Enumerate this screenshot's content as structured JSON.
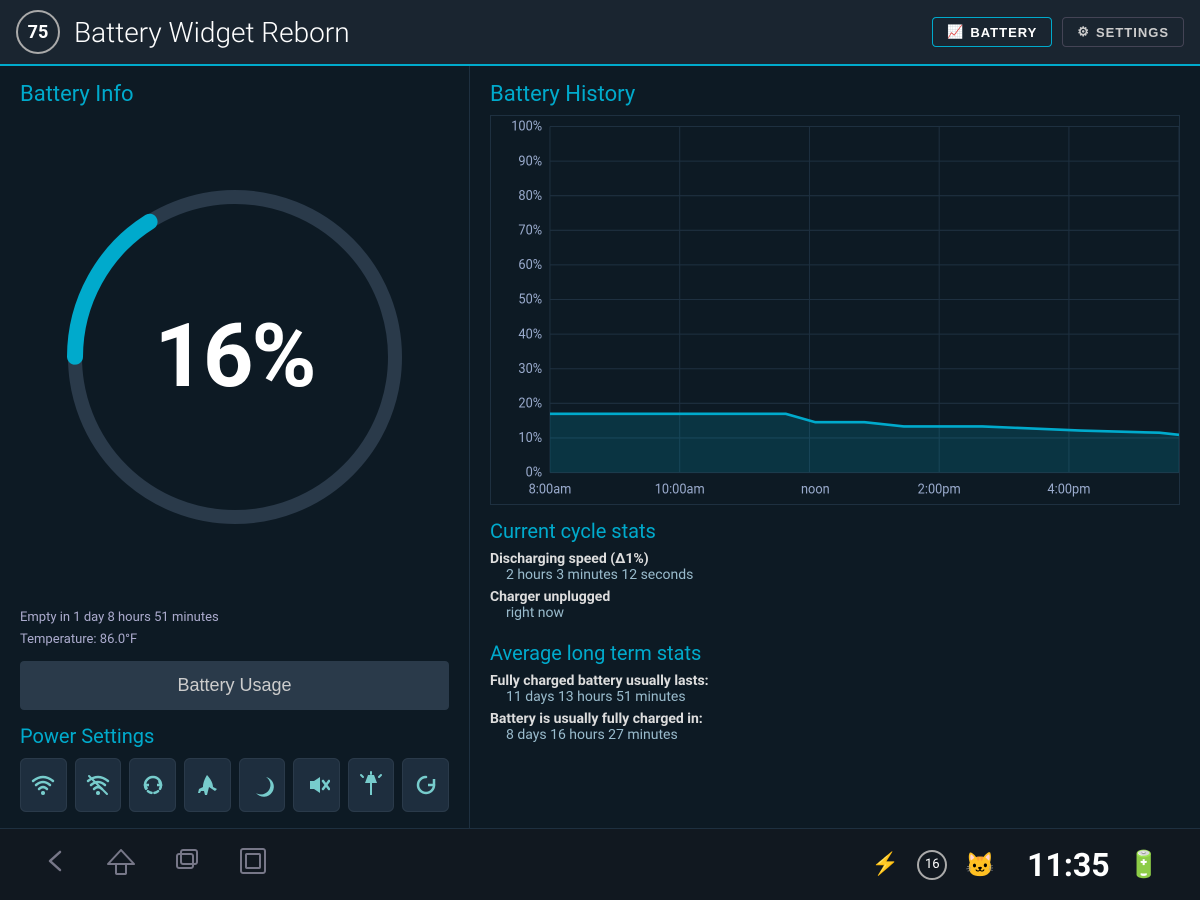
{
  "app": {
    "badge": "75",
    "title": "Battery Widget Reborn"
  },
  "topnav": {
    "battery_label": "BATTERY",
    "settings_label": "SETTINGS"
  },
  "battery_info": {
    "section_title": "Battery Info",
    "percent": "16%",
    "gauge_value": 16,
    "meta_line1": "Empty in 1 day 8 hours 51 minutes",
    "meta_line2": "Temperature: 86.0°F",
    "usage_btn": "Battery Usage"
  },
  "power_settings": {
    "title": "Power Settings",
    "icons": [
      "wifi",
      "wifi-off",
      "refresh",
      "airplane",
      "moon",
      "mute",
      "flashlight",
      "reset"
    ]
  },
  "battery_history": {
    "section_title": "Battery History",
    "y_labels": [
      "100%",
      "90%",
      "80%",
      "70%",
      "60%",
      "50%",
      "40%",
      "30%",
      "20%",
      "10%",
      "0%"
    ],
    "x_labels": [
      "8:00am",
      "10:00am",
      "noon",
      "2:00pm",
      "4:00pm"
    ],
    "accent_color": "#00aacc"
  },
  "cycle_stats": {
    "section_title": "Current cycle stats",
    "discharging_label": "Discharging speed (Δ1%)",
    "discharging_value": "2 hours 3 minutes 12 seconds",
    "charger_label": "Charger unplugged",
    "charger_value": "right now"
  },
  "avg_stats": {
    "section_title": "Average long term stats",
    "charged_label": "Fully charged battery usually lasts:",
    "charged_value": "11 days 13 hours 51 minutes",
    "charge_time_label": "Battery is usually fully charged in:",
    "charge_time_value": "8 days 16 hours 27 minutes"
  },
  "bottombar": {
    "usb_icon": "⚡",
    "badge_num": "16",
    "clock": "11:35"
  }
}
